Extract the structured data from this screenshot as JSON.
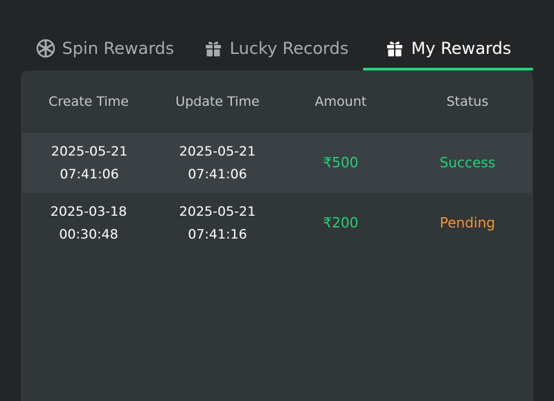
{
  "tabs": [
    {
      "label": "Spin Rewards",
      "icon": "wheel-icon",
      "active": false
    },
    {
      "label": "Lucky Records",
      "icon": "gift-icon",
      "active": false
    },
    {
      "label": "My Rewards",
      "icon": "gift-icon",
      "active": true
    }
  ],
  "table": {
    "columns": [
      "Create Time",
      "Update Time",
      "Amount",
      "Status"
    ],
    "rows": [
      {
        "create_date": "2025-05-21",
        "create_time": "07:41:06",
        "update_date": "2025-05-21",
        "update_time": "07:41:06",
        "amount": "₹500",
        "status": "Success"
      },
      {
        "create_date": "2025-03-18",
        "create_time": "00:30:48",
        "update_date": "2025-05-21",
        "update_time": "07:41:16",
        "amount": "₹200",
        "status": "Pending"
      }
    ]
  },
  "colors": {
    "background": "#232527",
    "panel": "#313638",
    "accent": "#22d07a",
    "pending": "#f4972d",
    "inactive_text": "#a7acaf"
  }
}
